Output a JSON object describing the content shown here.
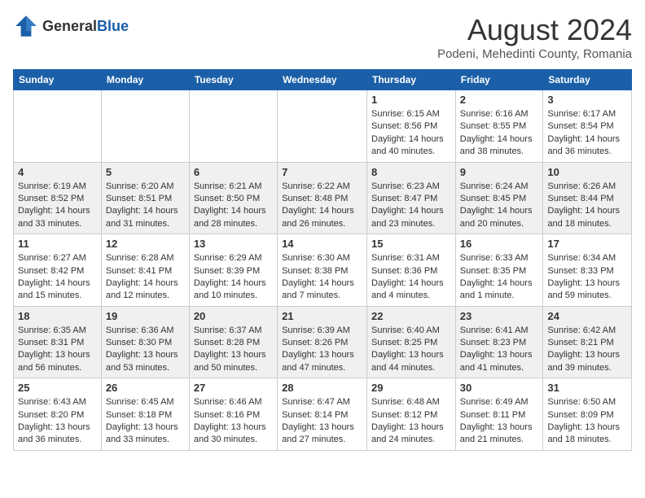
{
  "header": {
    "logo_general": "General",
    "logo_blue": "Blue",
    "month_title": "August 2024",
    "location": "Podeni, Mehedinti County, Romania"
  },
  "weekdays": [
    "Sunday",
    "Monday",
    "Tuesday",
    "Wednesday",
    "Thursday",
    "Friday",
    "Saturday"
  ],
  "weeks": [
    [
      {
        "day": "",
        "info": ""
      },
      {
        "day": "",
        "info": ""
      },
      {
        "day": "",
        "info": ""
      },
      {
        "day": "",
        "info": ""
      },
      {
        "day": "1",
        "info": "Sunrise: 6:15 AM\nSunset: 8:56 PM\nDaylight: 14 hours and 40 minutes."
      },
      {
        "day": "2",
        "info": "Sunrise: 6:16 AM\nSunset: 8:55 PM\nDaylight: 14 hours and 38 minutes."
      },
      {
        "day": "3",
        "info": "Sunrise: 6:17 AM\nSunset: 8:54 PM\nDaylight: 14 hours and 36 minutes."
      }
    ],
    [
      {
        "day": "4",
        "info": "Sunrise: 6:19 AM\nSunset: 8:52 PM\nDaylight: 14 hours and 33 minutes."
      },
      {
        "day": "5",
        "info": "Sunrise: 6:20 AM\nSunset: 8:51 PM\nDaylight: 14 hours and 31 minutes."
      },
      {
        "day": "6",
        "info": "Sunrise: 6:21 AM\nSunset: 8:50 PM\nDaylight: 14 hours and 28 minutes."
      },
      {
        "day": "7",
        "info": "Sunrise: 6:22 AM\nSunset: 8:48 PM\nDaylight: 14 hours and 26 minutes."
      },
      {
        "day": "8",
        "info": "Sunrise: 6:23 AM\nSunset: 8:47 PM\nDaylight: 14 hours and 23 minutes."
      },
      {
        "day": "9",
        "info": "Sunrise: 6:24 AM\nSunset: 8:45 PM\nDaylight: 14 hours and 20 minutes."
      },
      {
        "day": "10",
        "info": "Sunrise: 6:26 AM\nSunset: 8:44 PM\nDaylight: 14 hours and 18 minutes."
      }
    ],
    [
      {
        "day": "11",
        "info": "Sunrise: 6:27 AM\nSunset: 8:42 PM\nDaylight: 14 hours and 15 minutes."
      },
      {
        "day": "12",
        "info": "Sunrise: 6:28 AM\nSunset: 8:41 PM\nDaylight: 14 hours and 12 minutes."
      },
      {
        "day": "13",
        "info": "Sunrise: 6:29 AM\nSunset: 8:39 PM\nDaylight: 14 hours and 10 minutes."
      },
      {
        "day": "14",
        "info": "Sunrise: 6:30 AM\nSunset: 8:38 PM\nDaylight: 14 hours and 7 minutes."
      },
      {
        "day": "15",
        "info": "Sunrise: 6:31 AM\nSunset: 8:36 PM\nDaylight: 14 hours and 4 minutes."
      },
      {
        "day": "16",
        "info": "Sunrise: 6:33 AM\nSunset: 8:35 PM\nDaylight: 14 hours and 1 minute."
      },
      {
        "day": "17",
        "info": "Sunrise: 6:34 AM\nSunset: 8:33 PM\nDaylight: 13 hours and 59 minutes."
      }
    ],
    [
      {
        "day": "18",
        "info": "Sunrise: 6:35 AM\nSunset: 8:31 PM\nDaylight: 13 hours and 56 minutes."
      },
      {
        "day": "19",
        "info": "Sunrise: 6:36 AM\nSunset: 8:30 PM\nDaylight: 13 hours and 53 minutes."
      },
      {
        "day": "20",
        "info": "Sunrise: 6:37 AM\nSunset: 8:28 PM\nDaylight: 13 hours and 50 minutes."
      },
      {
        "day": "21",
        "info": "Sunrise: 6:39 AM\nSunset: 8:26 PM\nDaylight: 13 hours and 47 minutes."
      },
      {
        "day": "22",
        "info": "Sunrise: 6:40 AM\nSunset: 8:25 PM\nDaylight: 13 hours and 44 minutes."
      },
      {
        "day": "23",
        "info": "Sunrise: 6:41 AM\nSunset: 8:23 PM\nDaylight: 13 hours and 41 minutes."
      },
      {
        "day": "24",
        "info": "Sunrise: 6:42 AM\nSunset: 8:21 PM\nDaylight: 13 hours and 39 minutes."
      }
    ],
    [
      {
        "day": "25",
        "info": "Sunrise: 6:43 AM\nSunset: 8:20 PM\nDaylight: 13 hours and 36 minutes."
      },
      {
        "day": "26",
        "info": "Sunrise: 6:45 AM\nSunset: 8:18 PM\nDaylight: 13 hours and 33 minutes."
      },
      {
        "day": "27",
        "info": "Sunrise: 6:46 AM\nSunset: 8:16 PM\nDaylight: 13 hours and 30 minutes."
      },
      {
        "day": "28",
        "info": "Sunrise: 6:47 AM\nSunset: 8:14 PM\nDaylight: 13 hours and 27 minutes."
      },
      {
        "day": "29",
        "info": "Sunrise: 6:48 AM\nSunset: 8:12 PM\nDaylight: 13 hours and 24 minutes."
      },
      {
        "day": "30",
        "info": "Sunrise: 6:49 AM\nSunset: 8:11 PM\nDaylight: 13 hours and 21 minutes."
      },
      {
        "day": "31",
        "info": "Sunrise: 6:50 AM\nSunset: 8:09 PM\nDaylight: 13 hours and 18 minutes."
      }
    ]
  ]
}
